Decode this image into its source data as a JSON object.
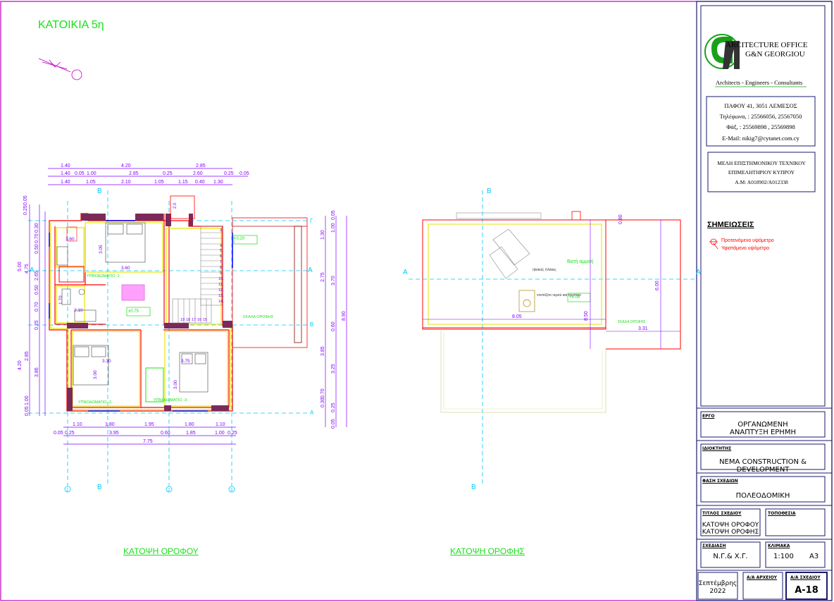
{
  "drawing": {
    "title": "ΚΑΤΟΙΚΙΑ 5η",
    "plan_left_caption": "ΚΑΤΟΨΗ ΟΡΟΦΟΥ",
    "plan_right_caption": "ΚΑΤΟΨΗ ΟΡΟΦΗΣ",
    "section_labels": {
      "a": "A",
      "b": "B",
      "g": "Γ"
    },
    "axis_numbers": [
      "1",
      "2",
      "3"
    ],
    "dims_top_row1": [
      "1.40",
      "4.20",
      "2.85"
    ],
    "dims_top_row2": [
      "1.40",
      "0.05",
      "1.00",
      "2.85",
      "0.25",
      "2.60",
      "0.25",
      "0.05"
    ],
    "dims_top_row3": [
      "1.40",
      "1.05",
      "2.10",
      "1.05",
      "1.15",
      "0.40",
      "1.30"
    ],
    "dims_bottom_row1": [
      "1.10",
      "1.80",
      "1.95",
      "1.80",
      "1.10"
    ],
    "dims_bottom_row2": [
      "0.05",
      "0.25",
      "3.95",
      "0.60",
      "1.85",
      "1.00",
      "0.25"
    ],
    "dims_bottom_total": "7.75",
    "dims_left": [
      "0.25",
      "0.05",
      "0.30",
      "0.70",
      "0.50",
      "0.50",
      "0.70",
      "0.50",
      "0.25",
      "2.85",
      "1.00",
      "0.05"
    ],
    "dims_left_outer": [
      "5.00",
      "4.75",
      "4.20",
      "3.86",
      "2.65"
    ],
    "dims_right": [
      "1.30",
      "2.75",
      "0.60",
      "3.25",
      "0.05",
      "0.25",
      "1.00",
      "0.05",
      "0.30",
      "0.70"
    ],
    "dims_right_outer": [
      "3.70",
      "3.85",
      "8.90"
    ],
    "rooms": {
      "bedroom1": "ΥΠΝΟΔΩΜΑΤΙΟ -1-",
      "bedroom2": "ΥΠΝΟΔΩΜΑΤΙΟ -2-",
      "bedroom3": "ΥΠΝΟΔΩΜΑΤΙΟ -3-",
      "stair_roof": "ΣΚΑΛΑ ΟΡΟΦΗΣ"
    },
    "room_dims": [
      "3.05",
      "3.60",
      "3.30",
      "3.75",
      "3.00",
      "3.00",
      "2.10",
      "1.70",
      "1.60"
    ],
    "levels": {
      "terrace": "+0.20",
      "floor": "±0.75",
      "roof": "+4.05"
    },
    "stair_steps": [
      "3.",
      "4.",
      "5.",
      "6.",
      "7.",
      "8.",
      "9.",
      "10.",
      "11.",
      "12.",
      "13.",
      "14.",
      "15",
      "16",
      "17",
      "18",
      "19"
    ],
    "roof_notes": {
      "gravel": "Βατή αμμοή",
      "panels": "ηλιακές πλάκες",
      "tank": "ντεπόζιτο νερού και πιεστικό",
      "stair": "ΣΚΑΛΑ ΟΡΟΦΗΣ"
    },
    "roof_dims": [
      "8.05",
      "8.50",
      "6.00",
      "3.31",
      "0.80"
    ]
  },
  "title_block": {
    "office_name_1": "ARCITECTURE OFFICE",
    "office_name_2": "G&N GEORGIOU",
    "tagline": "Architects - Engineers - Consultants",
    "address": "ΠΑΦΟΥ 41, 3051 ΛΕΜΕΣΟΣ",
    "phone": "Τηλέφωνα, : 25566056, 25567050",
    "fax": "Φάξ, : 25569898 , 25569898",
    "email": "E-Mail: nikig7@cytanet.com.cy",
    "membership_1": "ΜΕΛΗ ΕΠΙΣΤΗΜΟΝΙΚΟΥ ΤΕΧΝΙΚΟΥ",
    "membership_2": "ΕΠΙΜΕΛΗΤΗΡΙΟΥ ΚΥΠΡΟΥ",
    "membership_3": "Α.Μ: Α018902/Α012338",
    "notes_title": "ΣΗΜΕΙΩΣΕΙΣ",
    "note_proposed": "Προτεινόμενο υψόμετρο",
    "note_existing": "Υφιστάμενο υψόμετρο",
    "project_label": "ΕΡΓΟ",
    "project_line1": "ΟΡΓΑΝΩΜΕΝΗ",
    "project_line2": "ΑΝΑΠΤΥΞΗ ΕΡΗΜΗ",
    "owner_label": "ΙΔΙΟΚΤΗΤΗΣ",
    "owner_line1": "NEMA CONSTRUCTION &",
    "owner_line2": "DEVELOPMENT",
    "phase_label": "ΦΑΣΗ ΣΧΕΔΙΩΝ",
    "phase_value": "ΠΟΛΕΟΔΟΜΙΚΗ",
    "drawing_title_label": "ΤΙΤΛΟΣ ΣΧΕΔΙΟΥ",
    "drawing_title_1": "ΚΑΤΟΨΗ ΟΡΟΦΟΥ",
    "drawing_title_2": "ΚΑΤΟΨΗ ΟΡΟΦΗΣ",
    "location_label": "ΤΟΠΟΘΕΣΙΑ",
    "drawn_label": "ΣΧΕΔΙΑΣΗ",
    "drawn_value": "Ν.Γ.& Χ.Γ.",
    "scale_label": "ΚΛΙΜΑΚΑ",
    "scale_value": "1:100",
    "paper_value": "A3",
    "date_1": "Σεπτέμβρης",
    "date_2": "2022",
    "archive_label": "Α/Α ΑΡΧΕΙΟΥ",
    "sheet_label": "Α/Α ΣΧΕΔΙΟΥ",
    "sheet_value": "Α-18"
  },
  "colors": {
    "frame": "#c000c0",
    "wall": "#ff0000",
    "dimension": "#8000ff",
    "axis": "#00c8ff",
    "green": "#19e019",
    "yellow": "#e6e600",
    "border": "#1a1a6e"
  }
}
